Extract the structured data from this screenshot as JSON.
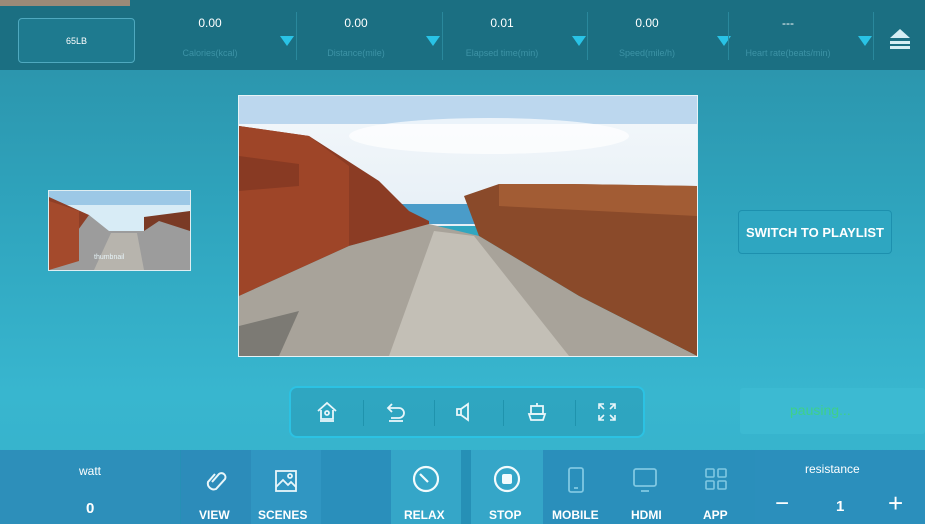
{
  "topbar": {
    "weight": "65LB",
    "stats": [
      {
        "value": "0.00",
        "label": "Calories(kcal)"
      },
      {
        "value": "0.00",
        "label": "Distance(mile)"
      },
      {
        "value": "0.01",
        "label": "Elapsed time(min)"
      },
      {
        "value": "0.00",
        "label": "Speed(mile/h)"
      },
      {
        "value": "---",
        "label": "Heart rate(beats/min)"
      }
    ]
  },
  "thumbnail": {
    "caption": "thumbnail"
  },
  "switch_label": "SWITCH TO PLAYLIST",
  "status_text": "pausing...",
  "controls": [
    "home-icon",
    "back-icon",
    "volume-icon",
    "cast-icon",
    "fullscreen-icon"
  ],
  "bottom": {
    "watt_label": "watt",
    "watt_value": "0",
    "view": "VIEW",
    "scenes": "SCENES",
    "relax": "RELAX",
    "stop": "STOP",
    "mobile": "MOBILE",
    "hdmi": "HDMI",
    "app": "APP",
    "resistance_label": "resistance",
    "resistance_value": "1",
    "minus": "−",
    "plus": "+"
  },
  "colors": {
    "accent": "#29c3e6",
    "status": "#3fd08a",
    "topbar": "#1b6f82"
  }
}
